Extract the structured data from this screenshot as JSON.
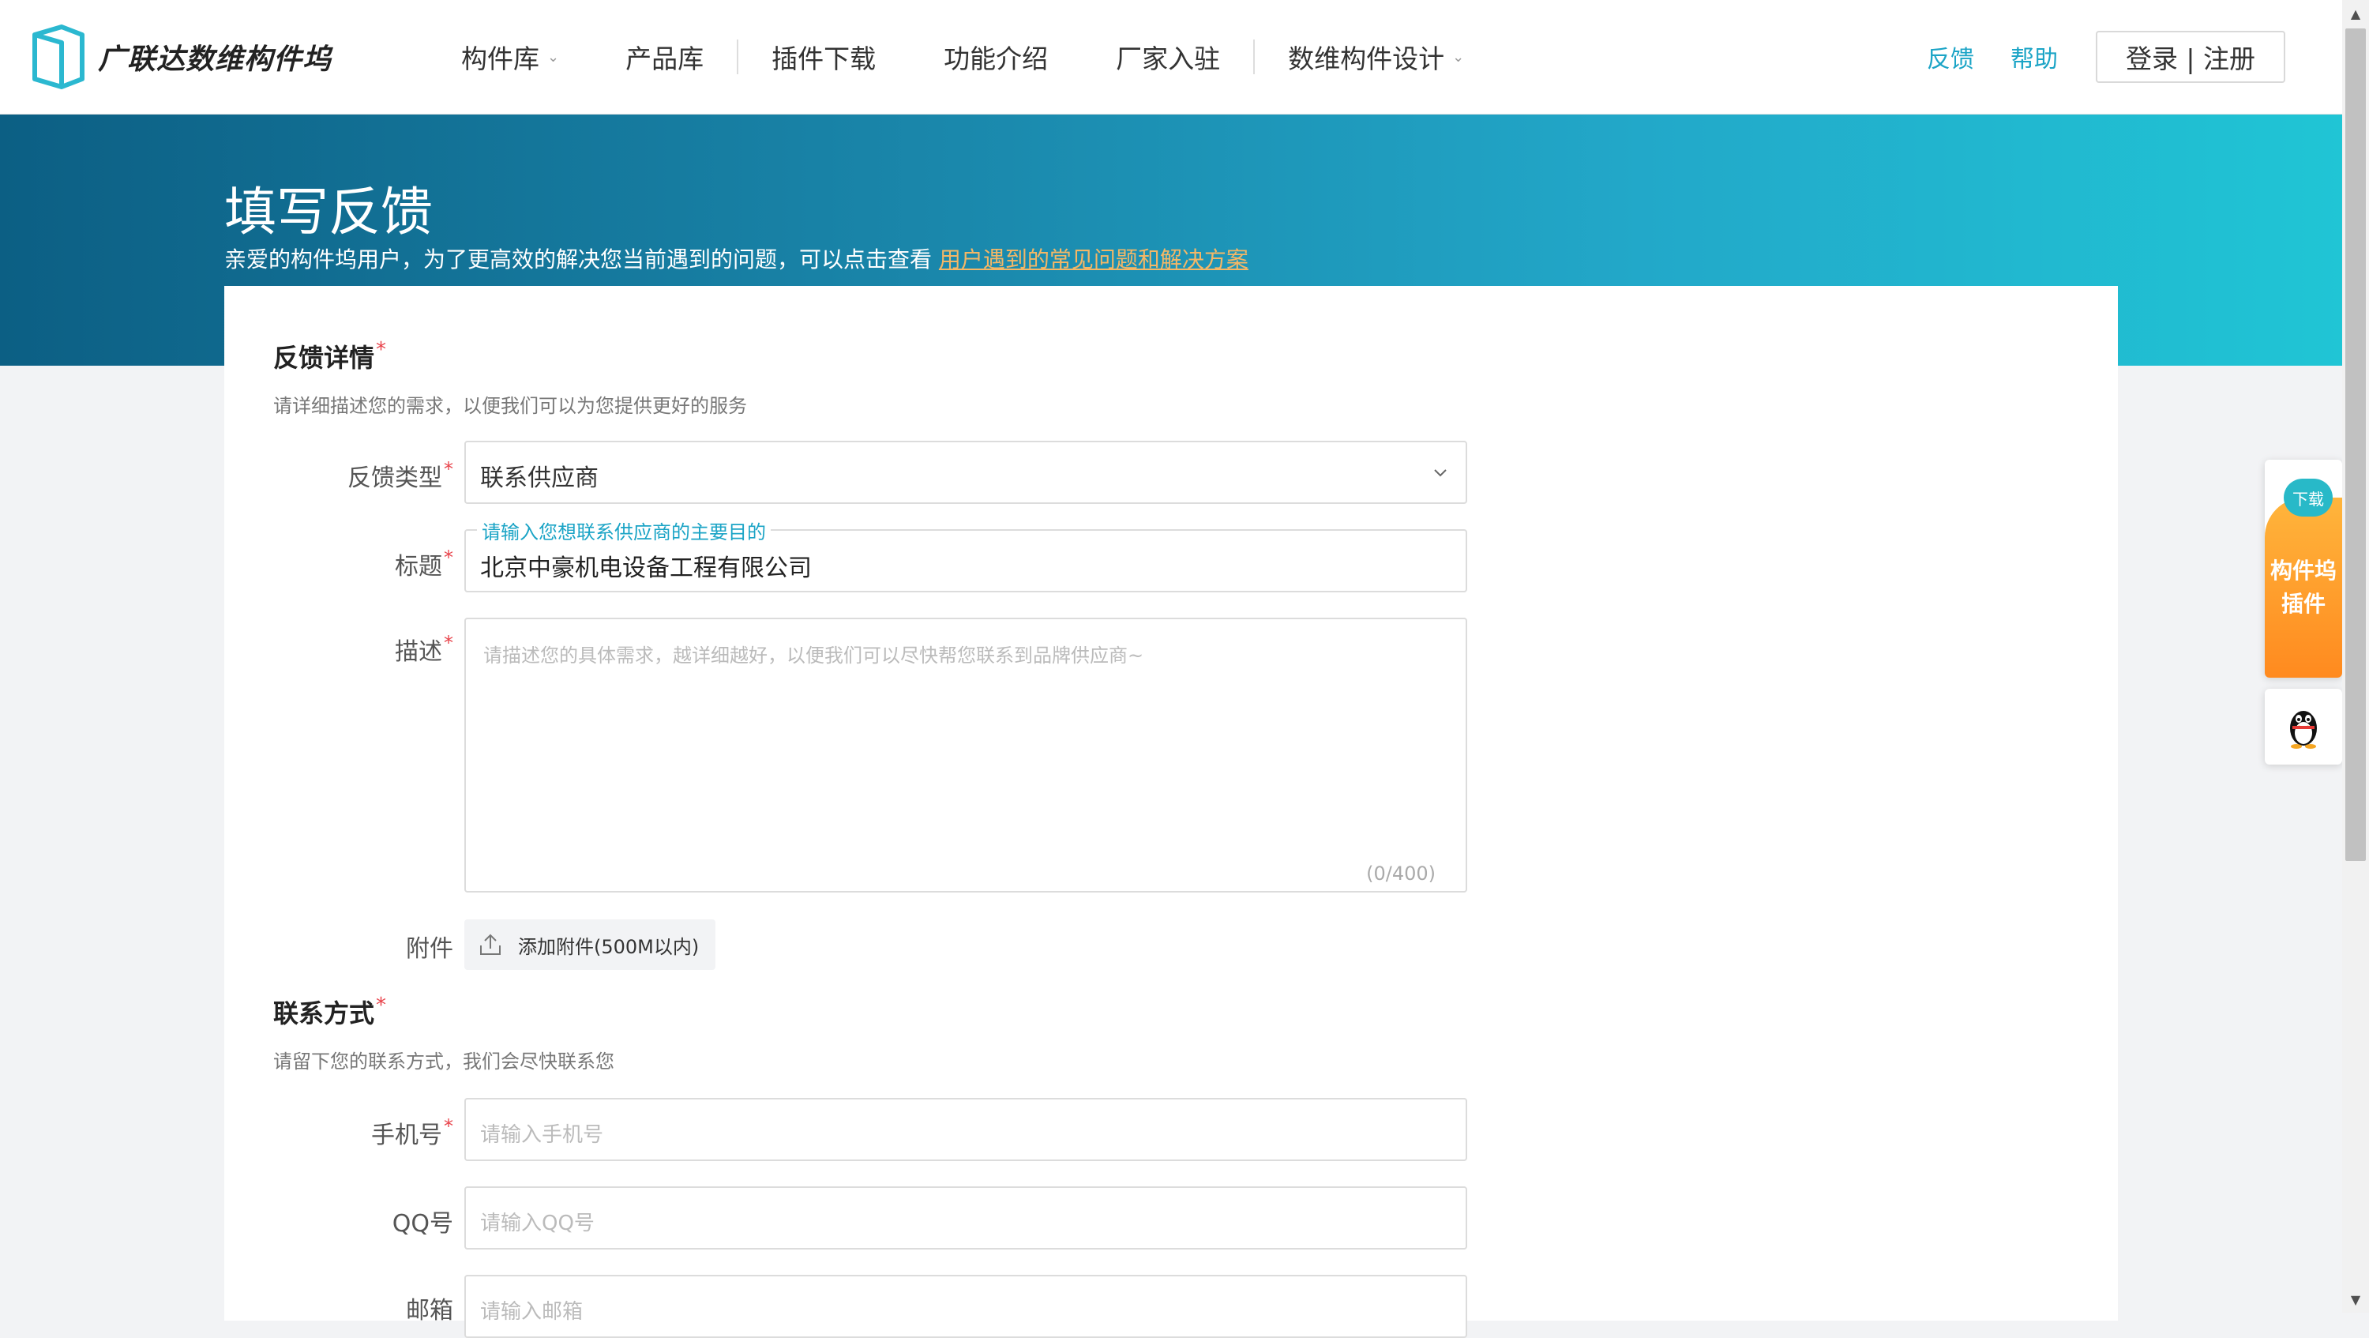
{
  "header": {
    "brand": "广联达数维构件坞",
    "nav": [
      {
        "label": "构件库",
        "dropdown": true
      },
      {
        "label": "产品库",
        "dropdown": false
      },
      {
        "label": "插件下载",
        "dropdown": false
      },
      {
        "label": "功能介绍",
        "dropdown": false
      },
      {
        "label": "厂家入驻",
        "dropdown": false
      },
      {
        "label": "数维构件设计",
        "dropdown": true
      }
    ],
    "feedback_link": "反馈",
    "help_link": "帮助",
    "login_label": "登录 | 注册"
  },
  "banner": {
    "title": "填写反馈",
    "subtitle": "亲爱的构件坞用户，为了更高效的解决您当前遇到的问题，可以点击查看 ",
    "faq_link": "用户遇到的常见问题和解决方案"
  },
  "form": {
    "details": {
      "title": "反馈详情",
      "desc": "请详细描述您的需求，以便我们可以为您提供更好的服务",
      "type_label": "反馈类型",
      "type_value": "联系供应商",
      "title_label": "标题",
      "title_float": "请输入您想联系供应商的主要目的",
      "title_value": "北京中豪机电设备工程有限公司",
      "desc_label": "描述",
      "desc_placeholder": "请描述您的具体需求，越详细越好，以便我们可以尽快帮您联系到品牌供应商~",
      "desc_count": "(0/400)",
      "attach_label": "附件",
      "attach_button": "添加附件(500M以内)"
    },
    "contact": {
      "title": "联系方式",
      "desc": "请留下您的联系方式，我们会尽快联系您",
      "phone_label": "手机号",
      "phone_placeholder": "请输入手机号",
      "qq_label": "QQ号",
      "qq_placeholder": "请输入QQ号",
      "email_label": "邮箱",
      "email_placeholder": "请输入邮箱"
    },
    "required_mark": "*"
  },
  "side": {
    "plugin_badge": "下载",
    "plugin_line1": "构件坞",
    "plugin_line2": "插件"
  },
  "colors": {
    "accent": "#1ba4c6",
    "required": "#e8434b",
    "link_orange": "#f4b766",
    "plugin_orange": "#ff9a2a"
  },
  "icons": {
    "logo": "logo-mark-icon",
    "dropdown": "chevron-down-icon",
    "upload": "upload-icon",
    "qq": "qq-penguin-icon"
  }
}
